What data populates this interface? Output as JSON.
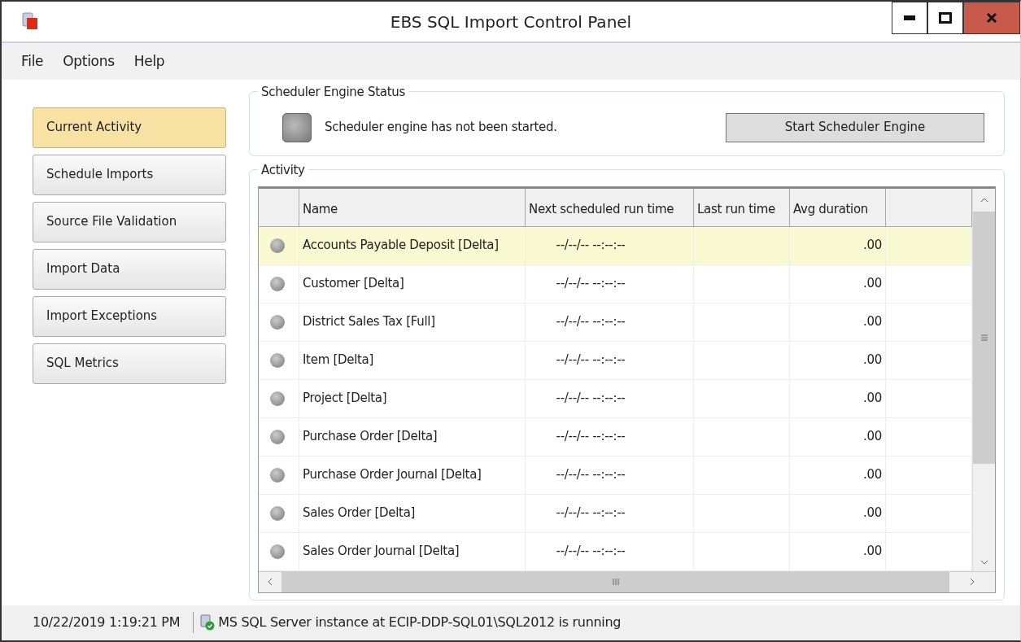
{
  "window": {
    "title": "EBS SQL Import Control Panel"
  },
  "menu": [
    "File",
    "Options",
    "Help"
  ],
  "nav": [
    {
      "label": "Current Activity",
      "selected": true
    },
    {
      "label": "Schedule Imports",
      "selected": false
    },
    {
      "label": "Source File Validation",
      "selected": false
    },
    {
      "label": "Import Data",
      "selected": false
    },
    {
      "label": "Import Exceptions",
      "selected": false
    },
    {
      "label": "SQL Metrics",
      "selected": false
    }
  ],
  "scheduler": {
    "title": "Scheduler Engine Status",
    "running": false,
    "message": "Scheduler engine has not been started.",
    "button": "Start Scheduler Engine"
  },
  "activity": {
    "title": "Activity",
    "columns": [
      "Name",
      "Next scheduled run time",
      "Last run time",
      "Avg duration"
    ],
    "rows": [
      {
        "name": "Accounts Payable Deposit [Delta]",
        "next": "--/--/-- --:--:--",
        "avg": ".00",
        "selected": true
      },
      {
        "name": "Customer [Delta]",
        "next": "--/--/-- --:--:--",
        "avg": ".00",
        "selected": false
      },
      {
        "name": "District Sales Tax [Full]",
        "next": "--/--/-- --:--:--",
        "avg": ".00",
        "selected": false
      },
      {
        "name": "Item [Delta]",
        "next": "--/--/-- --:--:--",
        "avg": ".00",
        "selected": false
      },
      {
        "name": "Project [Delta]",
        "next": "--/--/-- --:--:--",
        "avg": ".00",
        "selected": false
      },
      {
        "name": "Purchase Order [Delta]",
        "next": "--/--/-- --:--:--",
        "avg": ".00",
        "selected": false
      },
      {
        "name": "Purchase Order Journal [Delta]",
        "next": "--/--/-- --:--:--",
        "avg": ".00",
        "selected": false
      },
      {
        "name": "Sales Order [Delta]",
        "next": "--/--/-- --:--:--",
        "avg": ".00",
        "selected": false
      },
      {
        "name": "Sales Order Journal [Delta]",
        "next": "--/--/-- --:--:--",
        "avg": ".00",
        "selected": false
      }
    ]
  },
  "status_bar": {
    "datetime": "10/22/2019 1:19:21 PM",
    "message": "MS SQL Server instance at ECIP-DDP-SQL01\\SQL2012 is running"
  }
}
